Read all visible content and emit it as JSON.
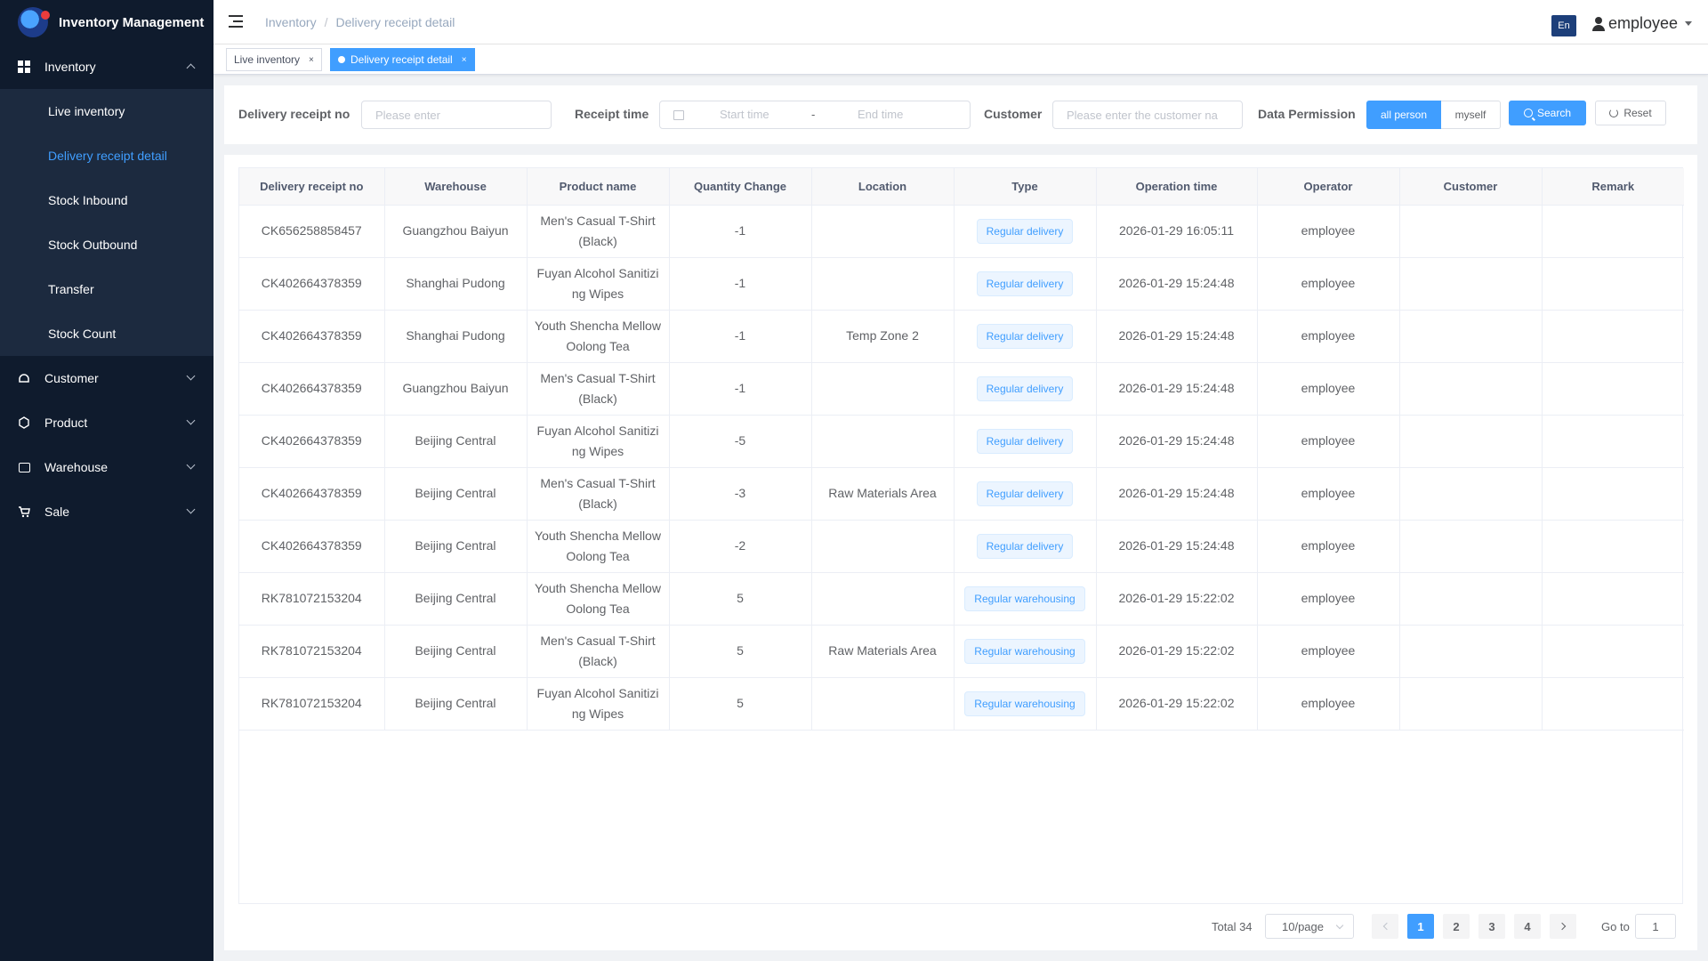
{
  "app": {
    "title": "Inventory Management"
  },
  "sidebar": {
    "inventory": {
      "label": "Inventory",
      "children": [
        "Live inventory",
        "Delivery receipt detail",
        "Stock Inbound",
        "Stock Outbound",
        "Transfer",
        "Stock Count"
      ]
    },
    "others": [
      {
        "label": "Customer",
        "icon": "customer-icon"
      },
      {
        "label": "Product",
        "icon": "product-icon"
      },
      {
        "label": "Warehouse",
        "icon": "warehouse-icon"
      },
      {
        "label": "Sale",
        "icon": "cart-icon"
      }
    ]
  },
  "header": {
    "breadcrumb": [
      "Inventory",
      "Delivery receipt detail"
    ],
    "lang": "En",
    "user": "employee"
  },
  "tags": [
    {
      "label": "Live inventory",
      "active": false
    },
    {
      "label": "Delivery receipt detail",
      "active": true
    }
  ],
  "search": {
    "receipt_label": "Delivery receipt no",
    "receipt_placeholder": "Please enter",
    "time_label": "Receipt time",
    "start_placeholder": "Start time",
    "range_sep": "-",
    "end_placeholder": "End time",
    "customer_label": "Customer",
    "customer_placeholder": "Please enter the customer na",
    "permission_label": "Data Permission",
    "permission_options": [
      "all person",
      "myself"
    ],
    "search_button": "Search",
    "reset_button": "Reset"
  },
  "table": {
    "columns": [
      "Delivery receipt no",
      "Warehouse",
      "Product name",
      "Quantity Change",
      "Location",
      "Type",
      "Operation time",
      "Operator",
      "Customer",
      "Remark"
    ],
    "rows": [
      [
        "CK656258858457",
        "Guangzhou Baiyun",
        "Men's Casual T-Shirt (Black)",
        "-1",
        "",
        "Regular delivery",
        "2026-01-29 16:05:11",
        "employee",
        "",
        ""
      ],
      [
        "CK402664378359",
        "Shanghai Pudong",
        "Fuyan Alcohol Sanitizing Wipes",
        "-1",
        "",
        "Regular delivery",
        "2026-01-29 15:24:48",
        "employee",
        "",
        ""
      ],
      [
        "CK402664378359",
        "Shanghai Pudong",
        "Youth Shencha Mellow Oolong Tea",
        "-1",
        "Temp Zone 2",
        "Regular delivery",
        "2026-01-29 15:24:48",
        "employee",
        "",
        ""
      ],
      [
        "CK402664378359",
        "Guangzhou Baiyun",
        "Men's Casual T-Shirt (Black)",
        "-1",
        "",
        "Regular delivery",
        "2026-01-29 15:24:48",
        "employee",
        "",
        ""
      ],
      [
        "CK402664378359",
        "Beijing Central",
        "Fuyan Alcohol Sanitizing Wipes",
        "-5",
        "",
        "Regular delivery",
        "2026-01-29 15:24:48",
        "employee",
        "",
        ""
      ],
      [
        "CK402664378359",
        "Beijing Central",
        "Men's Casual T-Shirt (Black)",
        "-3",
        "Raw Materials Area",
        "Regular delivery",
        "2026-01-29 15:24:48",
        "employee",
        "",
        ""
      ],
      [
        "CK402664378359",
        "Beijing Central",
        "Youth Shencha Mellow Oolong Tea",
        "-2",
        "",
        "Regular delivery",
        "2026-01-29 15:24:48",
        "employee",
        "",
        ""
      ],
      [
        "RK781072153204",
        "Beijing Central",
        "Youth Shencha Mellow Oolong Tea",
        "5",
        "",
        "Regular warehousing",
        "2026-01-29 15:22:02",
        "employee",
        "",
        ""
      ],
      [
        "RK781072153204",
        "Beijing Central",
        "Men's Casual T-Shirt (Black)",
        "5",
        "Raw Materials Area",
        "Regular warehousing",
        "2026-01-29 15:22:02",
        "employee",
        "",
        ""
      ],
      [
        "RK781072153204",
        "Beijing Central",
        "Fuyan Alcohol Sanitizing Wipes",
        "5",
        "",
        "Regular warehousing",
        "2026-01-29 15:22:02",
        "employee",
        "",
        ""
      ]
    ]
  },
  "pagination": {
    "total": "Total 34",
    "page_size": "10/page",
    "pages": [
      "1",
      "2",
      "3",
      "4"
    ],
    "current": "1",
    "goto_label": "Go to",
    "goto_value": "1"
  },
  "colors": {
    "sidebar_bg": "#0f1b2d",
    "submenu_bg": "#1c2a3f",
    "accent": "#409eff"
  }
}
